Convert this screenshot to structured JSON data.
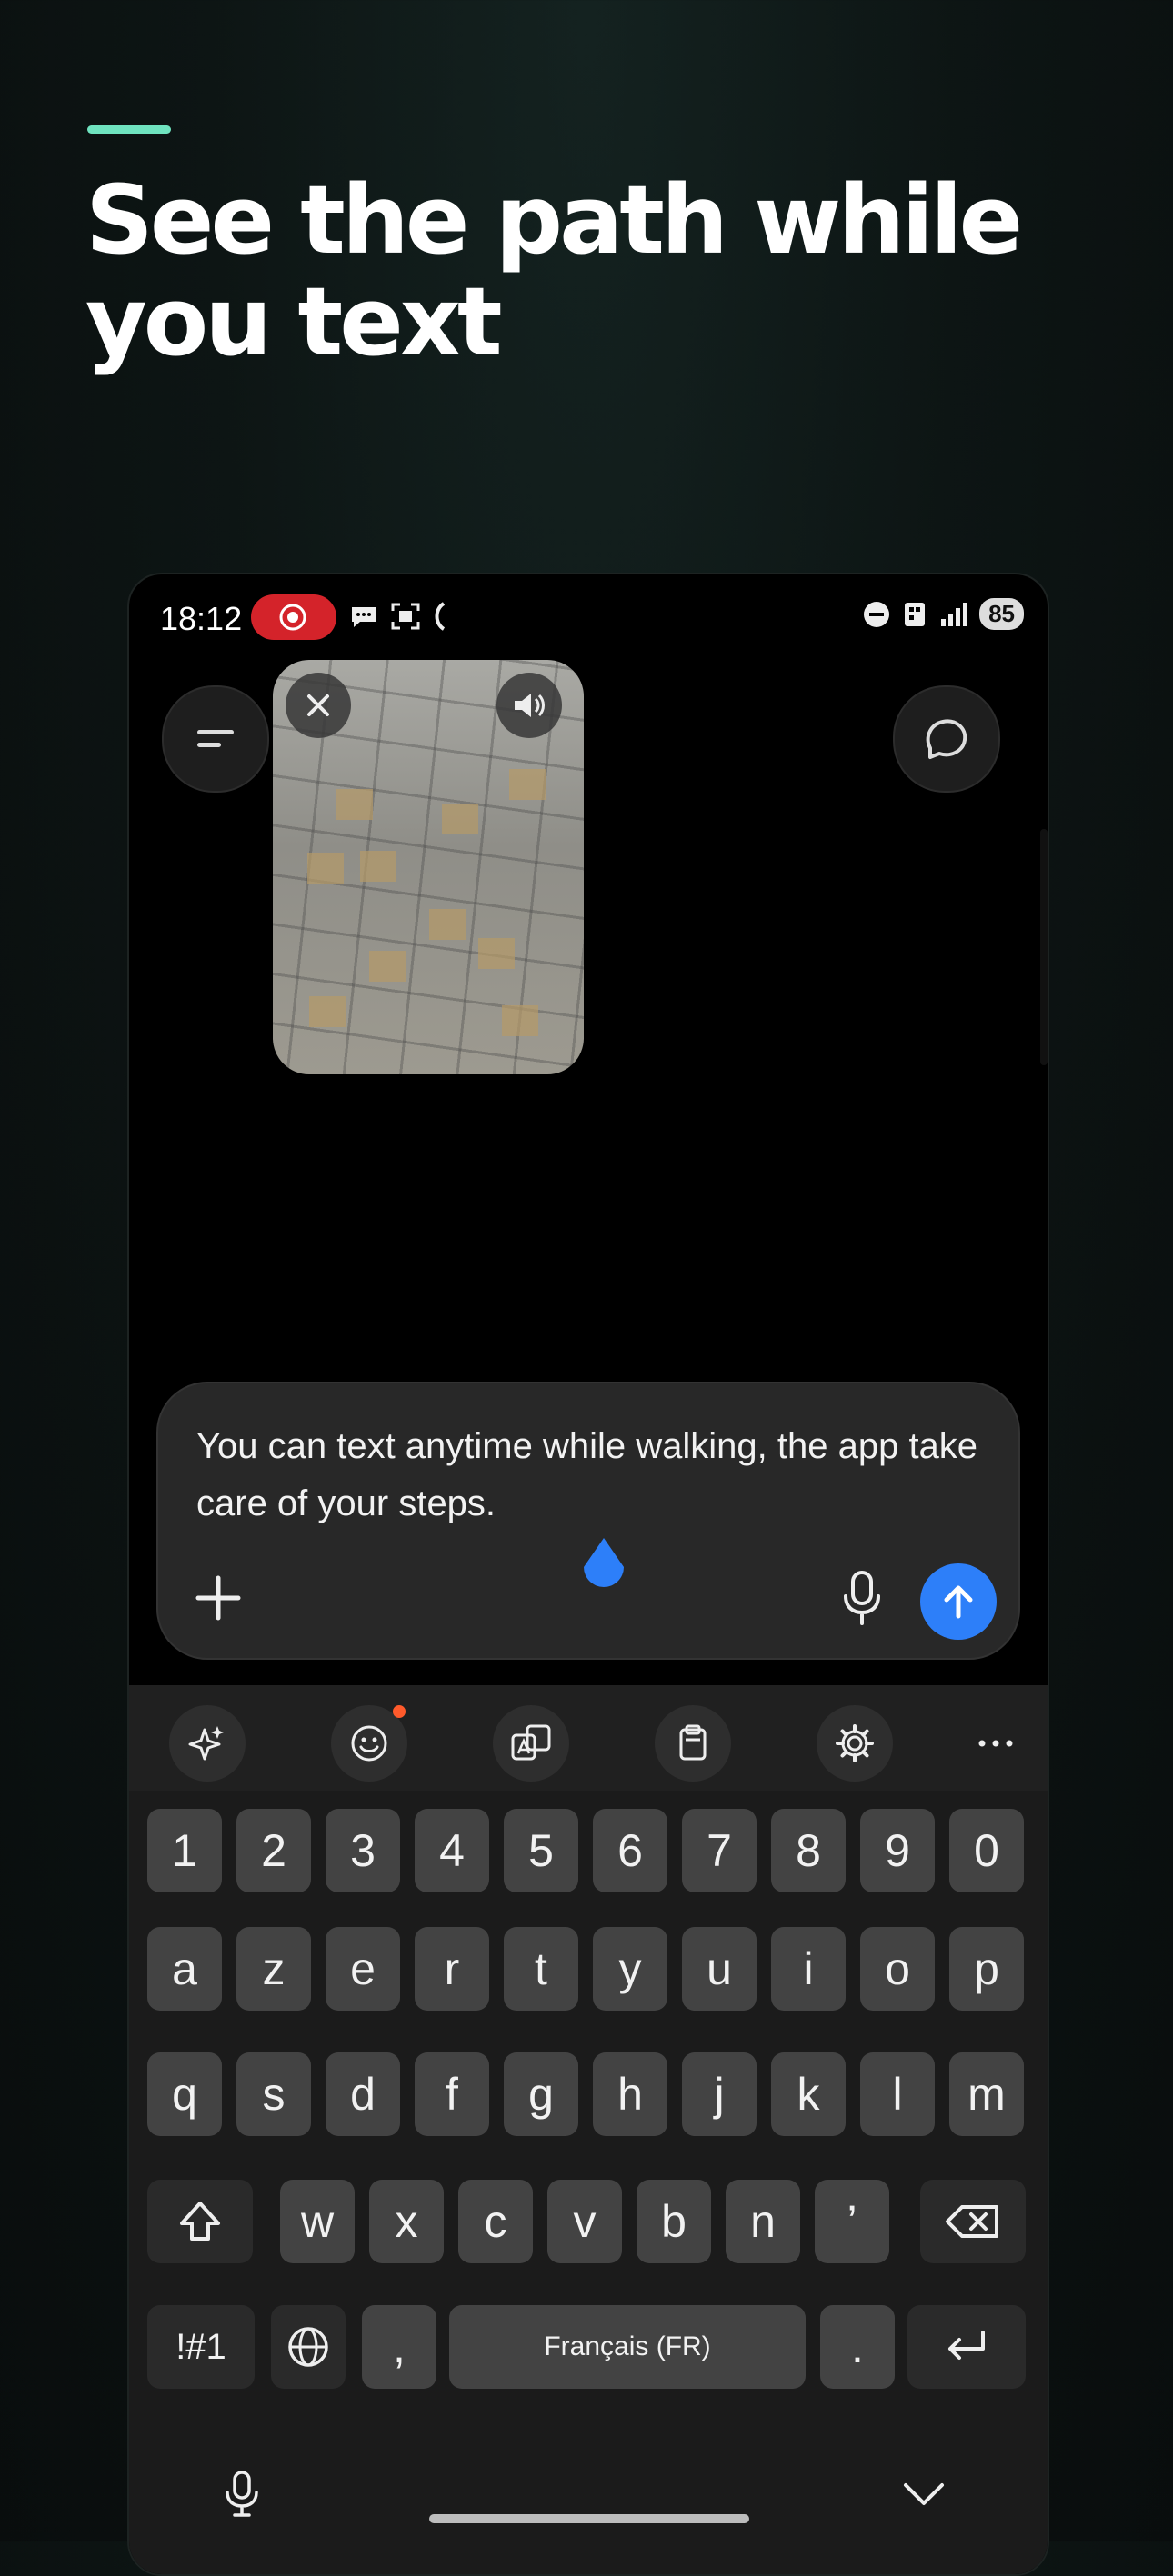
{
  "headline": {
    "text": "See the path while you text",
    "accent_color": "#6fe3bf"
  },
  "status_bar": {
    "time": "18:12",
    "battery": "85"
  },
  "composer": {
    "text": "You can text anytime while walking, the app take care of your steps.",
    "send_color": "#2d7ff9"
  },
  "keyboard": {
    "row_numbers": [
      "1",
      "2",
      "3",
      "4",
      "5",
      "6",
      "7",
      "8",
      "9",
      "0"
    ],
    "row_1": [
      "a",
      "z",
      "e",
      "r",
      "t",
      "y",
      "u",
      "i",
      "o",
      "p"
    ],
    "row_2": [
      "q",
      "s",
      "d",
      "f",
      "g",
      "h",
      "j",
      "k",
      "l",
      "m"
    ],
    "row_3": [
      "w",
      "x",
      "c",
      "v",
      "b",
      "n",
      "’"
    ],
    "symbols_key": "!#1",
    "comma_key": ",",
    "space_label": "Français (FR)",
    "period_key": "."
  }
}
